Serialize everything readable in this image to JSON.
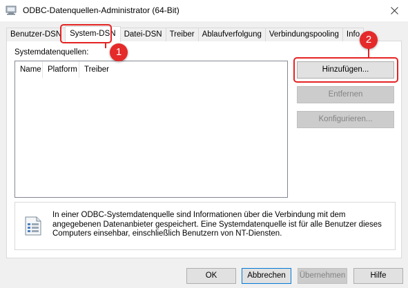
{
  "window": {
    "title": "ODBC-Datenquellen-Administrator (64-Bit)",
    "close_icon": "close-icon",
    "app_icon": "odbc-app-icon"
  },
  "tabs": [
    {
      "label": "Benutzer-DSN",
      "active": false
    },
    {
      "label": "System-DSN",
      "active": true
    },
    {
      "label": "Datei-DSN",
      "active": false
    },
    {
      "label": "Treiber",
      "active": false
    },
    {
      "label": "Ablaufverfolgung",
      "active": false
    },
    {
      "label": "Verbindungspooling",
      "active": false
    },
    {
      "label": "Info",
      "active": false
    }
  ],
  "panel": {
    "section_label": "Systemdatenquellen:",
    "columns": [
      "Name",
      "Platform",
      "Treiber"
    ],
    "side_buttons": {
      "add": "Hinzufügen...",
      "remove": "Entfernen",
      "configure": "Konfigurieren..."
    },
    "info_text": "In einer ODBC-Systemdatenquelle sind Informationen über die Verbindung mit dem angegebenen Datenanbieter gespeichert. Eine Systemdatenquelle ist für alle Benutzer dieses Computers einsehbar, einschließlich Benutzern von NT-Diensten."
  },
  "footer": {
    "ok": "OK",
    "cancel": "Abbrechen",
    "apply": "Übernehmen",
    "help": "Hilfe"
  },
  "annotations": {
    "badge_1": "1",
    "badge_2": "2",
    "color": "#e52222"
  },
  "colors": {
    "accent": "#0078d7",
    "dialog_bg": "#f0f0f0",
    "button_bg": "#e1e1e1"
  }
}
